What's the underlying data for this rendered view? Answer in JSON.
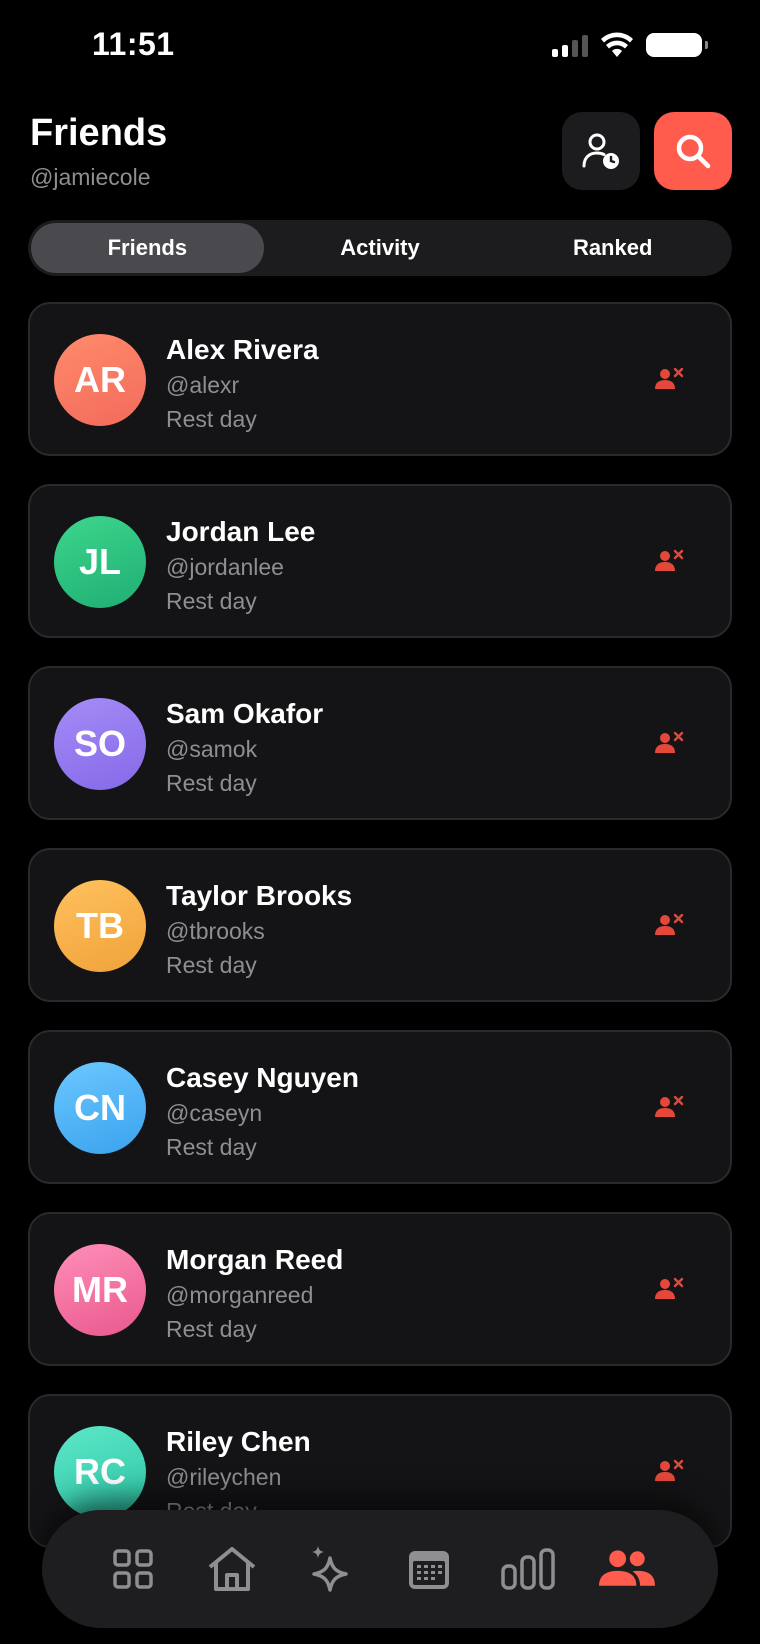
{
  "status_bar": {
    "time": "11:51"
  },
  "header": {
    "title": "Friends",
    "handle": "@jamiecole"
  },
  "segments": [
    {
      "label": "Friends",
      "active": true
    },
    {
      "label": "Activity",
      "active": false
    },
    {
      "label": "Ranked",
      "active": false
    }
  ],
  "friends": [
    {
      "initials": "AR",
      "name": "Alex Rivera",
      "handle": "@alexr",
      "status": "Rest day",
      "color_from": "#ff8a6b",
      "color_to": "#f26b5b"
    },
    {
      "initials": "JL",
      "name": "Jordan Lee",
      "handle": "@jordanlee",
      "status": "Rest day",
      "color_from": "#3dd68c",
      "color_to": "#1fae74"
    },
    {
      "initials": "SO",
      "name": "Sam Okafor",
      "handle": "@samok",
      "status": "Rest day",
      "color_from": "#a48cf7",
      "color_to": "#8569e8"
    },
    {
      "initials": "TB",
      "name": "Taylor Brooks",
      "handle": "@tbrooks",
      "status": "Rest day",
      "color_from": "#ffc15e",
      "color_to": "#f0a23a"
    },
    {
      "initials": "CN",
      "name": "Casey Nguyen",
      "handle": "@caseyn",
      "status": "Rest day",
      "color_from": "#6cc8ff",
      "color_to": "#3aa2ee"
    },
    {
      "initials": "MR",
      "name": "Morgan Reed",
      "handle": "@morganreed",
      "status": "Rest day",
      "color_from": "#ff8fb8",
      "color_to": "#e9588e"
    },
    {
      "initials": "RC",
      "name": "Riley Chen",
      "handle": "@rileychen",
      "status": "Rest day",
      "color_from": "#5ee8c8",
      "color_to": "#2cc4a5"
    }
  ],
  "tab_bar": {
    "items": [
      {
        "icon": "grid-icon",
        "active": false
      },
      {
        "icon": "home-icon",
        "active": false
      },
      {
        "icon": "sparkles-icon",
        "active": false
      },
      {
        "icon": "calendar-icon",
        "active": false
      },
      {
        "icon": "bar-chart-icon",
        "active": false
      },
      {
        "icon": "people-icon",
        "active": true
      }
    ]
  },
  "colors": {
    "accent": "#ff5c4d",
    "remove": "#e5483b",
    "muted": "#8e8e93",
    "card": "#141416"
  }
}
